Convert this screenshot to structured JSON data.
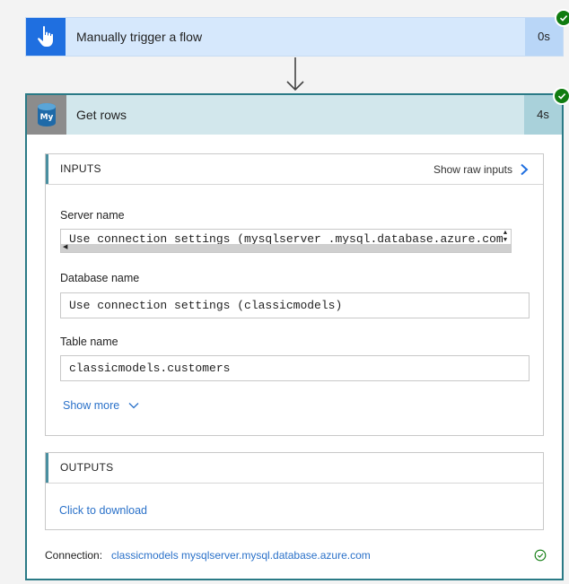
{
  "trigger": {
    "title": "Manually trigger a flow",
    "duration": "0s",
    "icon": "hand-pointer-icon",
    "status": "succeeded"
  },
  "action": {
    "title": "Get rows",
    "duration": "4s",
    "icon": "mysql-logo-icon",
    "icon_text": "My",
    "status": "succeeded",
    "inputs": {
      "title": "INPUTS",
      "raw_inputs_label": "Show raw inputs",
      "fields": [
        {
          "label": "Server name",
          "value": "Use connection settings (mysqlserver .mysql.database.azure.com)"
        },
        {
          "label": "Database name",
          "value": "Use connection settings (classicmodels)"
        },
        {
          "label": "Table name",
          "value": "classicmodels.customers"
        }
      ],
      "show_more_label": "Show more"
    },
    "outputs": {
      "title": "OUTPUTS",
      "download_label": "Click to download"
    },
    "connection": {
      "label": "Connection:",
      "value": "classicmodels mysqlserver.mysql.database.azure.com"
    }
  },
  "colors": {
    "trigger_icon_bg": "#1f6fe0",
    "trigger_bg": "#d6e8fc",
    "action_border": "#2a7a86",
    "action_header_bg": "#d2e7ec",
    "success_green": "#107c10",
    "link_blue": "#2a71c9"
  }
}
